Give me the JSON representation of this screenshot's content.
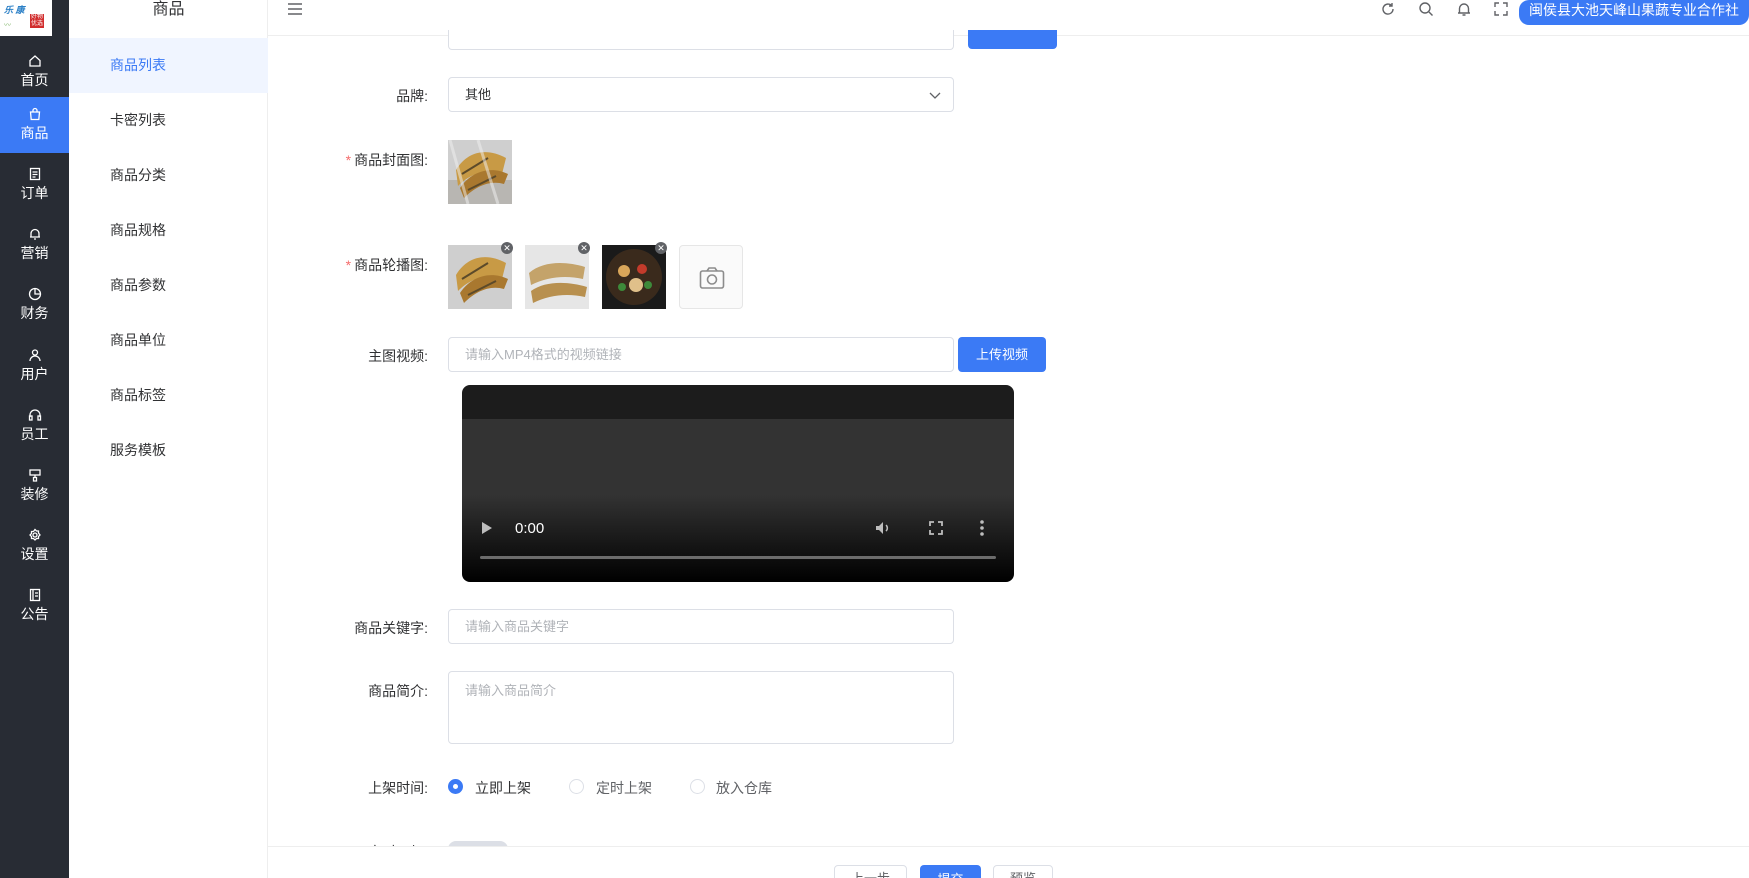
{
  "sidebar": {
    "logo_text_1": "乐 康",
    "logo_text_2": "好物 优选",
    "items": [
      {
        "label": "首页",
        "icon": "home-icon"
      },
      {
        "label": "商品",
        "icon": "bag-icon"
      },
      {
        "label": "订单",
        "icon": "order-icon"
      },
      {
        "label": "营销",
        "icon": "bell-icon"
      },
      {
        "label": "财务",
        "icon": "pie-icon"
      },
      {
        "label": "用户",
        "icon": "user-icon"
      },
      {
        "label": "员工",
        "icon": "headset-icon"
      },
      {
        "label": "装修",
        "icon": "brush-icon"
      },
      {
        "label": "设置",
        "icon": "gear-icon"
      },
      {
        "label": "公告",
        "icon": "notice-icon"
      }
    ],
    "active_index": 1
  },
  "submenu": {
    "title": "商品",
    "items": [
      "商品列表",
      "卡密列表",
      "商品分类",
      "商品规格",
      "商品参数",
      "商品单位",
      "商品标签",
      "服务模板"
    ],
    "active_index": 0
  },
  "header": {
    "shop_name": "闽侯县大池天峰山果蔬专业合作社"
  },
  "form": {
    "brand_label": "品牌:",
    "brand_value": "其他",
    "cover_label": "商品封面图:",
    "carousel_label": "商品轮播图:",
    "video_label": "主图视频:",
    "video_placeholder": "请输入MP4格式的视频链接",
    "upload_video_btn": "上传视频",
    "video_time": "0:00",
    "keyword_label": "商品关键字:",
    "keyword_placeholder": "请输入商品关键字",
    "intro_label": "商品简介:",
    "intro_placeholder": "请输入商品简介",
    "shelf_label": "上架时间:",
    "shelf_options": [
      "立即上架",
      "定时上架",
      "放入仓库"
    ],
    "shelf_selected": "立即上架",
    "offshelf_label": "定时下架:",
    "required_mark": "*"
  },
  "footer": {
    "prev_btn": "上一步",
    "submit_btn": "提交",
    "preview_btn": "预览"
  },
  "colors": {
    "primary": "#3b7af5",
    "sidebar_bg": "#282c34",
    "required": "#f56c6c"
  }
}
